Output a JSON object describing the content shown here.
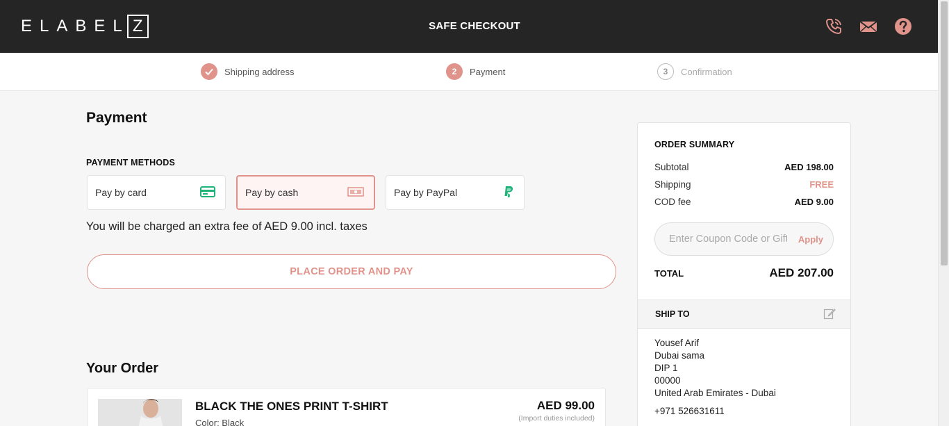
{
  "header": {
    "logo_letters": "ELABEL",
    "logo_box_letter": "Z",
    "title": "SAFE CHECKOUT",
    "icons": [
      "phone-icon",
      "mail-icon",
      "help-icon"
    ],
    "accent_color": "#e0938a"
  },
  "steps": [
    {
      "number": "✓",
      "label": "Shipping address",
      "state": "done"
    },
    {
      "number": "2",
      "label": "Payment",
      "state": "active"
    },
    {
      "number": "3",
      "label": "Confirmation",
      "state": "pending"
    }
  ],
  "payment": {
    "title": "Payment",
    "methods_label": "PAYMENT METHODS",
    "methods": [
      {
        "label": "Pay by card",
        "icon": "credit-card-icon"
      },
      {
        "label": "Pay by cash",
        "icon": "cash-icon",
        "selected": true
      },
      {
        "label": "Pay by PayPal",
        "icon": "paypal-icon"
      }
    ],
    "fee_note": "You will be charged an extra fee of AED 9.00 incl. taxes",
    "place_order_label": "PLACE ORDER AND PAY"
  },
  "order": {
    "title": "Your Order",
    "item": {
      "name": "BLACK THE ONES PRINT T-SHIRT",
      "color": "Color: Black",
      "price": "AED 99.00",
      "duty_note": "(Import duties included)"
    }
  },
  "summary": {
    "title": "ORDER SUMMARY",
    "subtotal_label": "Subtotal",
    "subtotal_value": "AED 198.00",
    "shipping_label": "Shipping",
    "shipping_value": "FREE",
    "cod_label": "COD fee",
    "cod_value": "AED 9.00",
    "coupon_placeholder": "Enter Coupon Code or Gift Card",
    "coupon_value": "",
    "apply_label": "Apply",
    "total_label": "TOTAL",
    "total_value": "AED 207.00"
  },
  "ship_to": {
    "title": "SHIP TO",
    "name": "Yousef Arif",
    "line1": "Dubai sama",
    "line2": "DIP 1",
    "postcode": "00000",
    "country": "United Arab Emirates - Dubai",
    "phone": "+971 526631611"
  }
}
